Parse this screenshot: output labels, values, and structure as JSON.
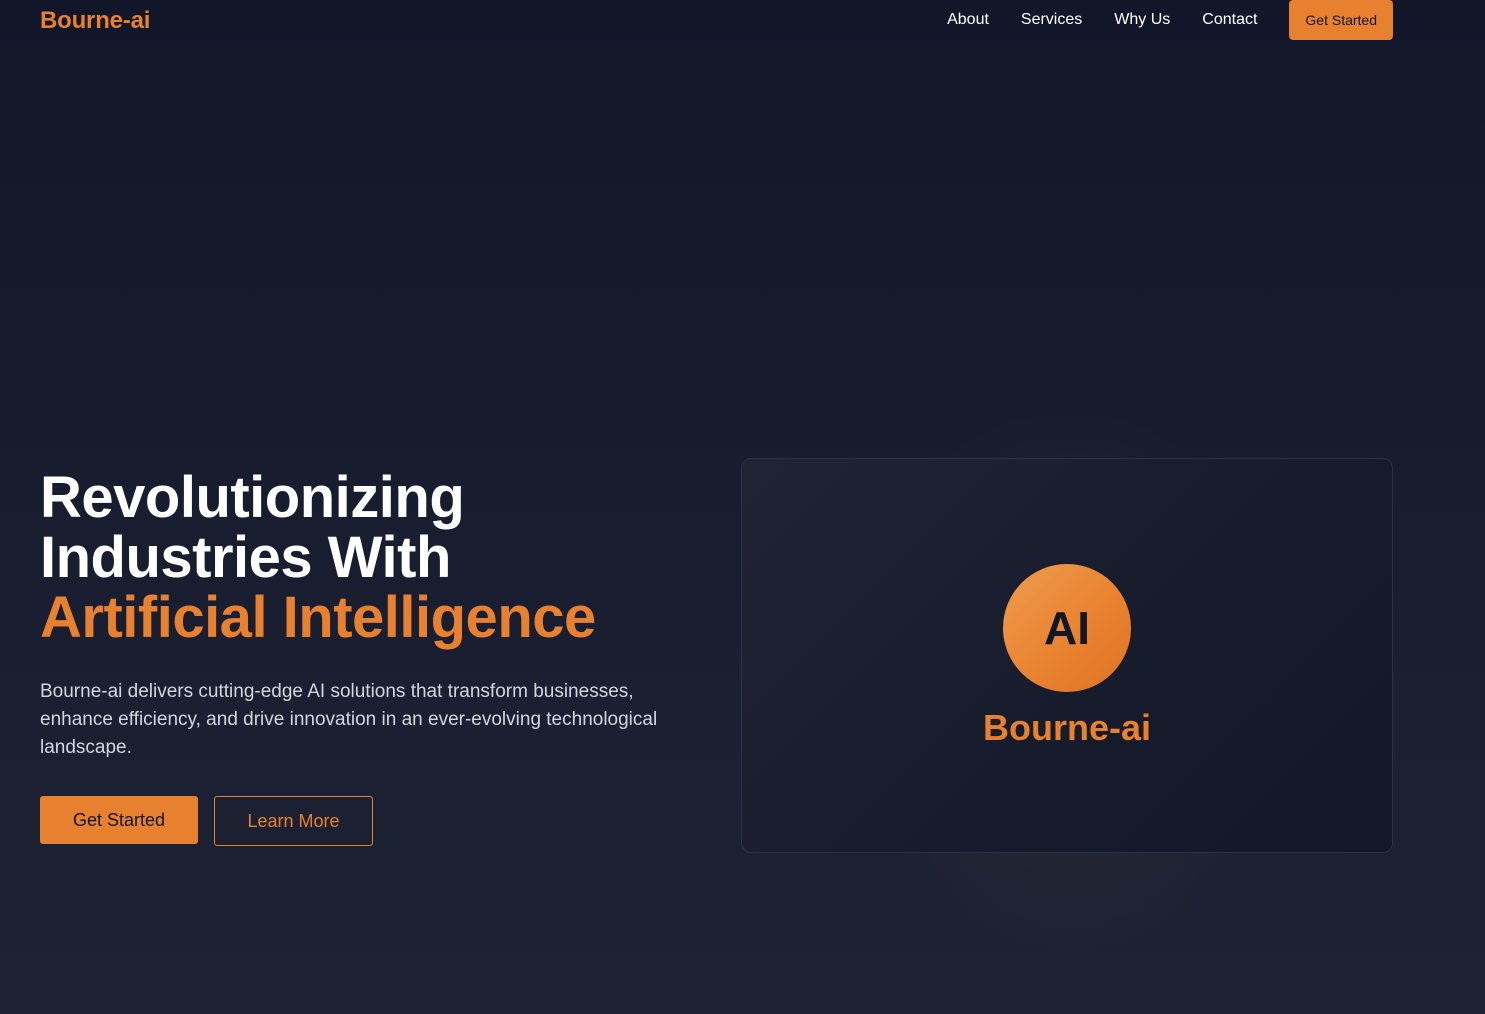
{
  "brand": {
    "name": "Bourne-ai",
    "accent_color": "#e8812f",
    "background_color": "#111629"
  },
  "nav": {
    "links": [
      {
        "label": "About"
      },
      {
        "label": "Services"
      },
      {
        "label": "Why Us"
      },
      {
        "label": "Contact"
      }
    ],
    "cta_label": "Get Started"
  },
  "hero": {
    "title_line1": "Revolutionizing",
    "title_line2": "Industries With",
    "title_accent": "Artificial Intelligence",
    "description": "Bourne-ai delivers cutting-edge AI solutions that transform businesses, enhance efficiency, and drive innovation in an ever-evolving technological landscape.",
    "primary_button": "Get Started",
    "secondary_button": "Learn More"
  },
  "card": {
    "badge_text": "AI",
    "brand_name": "Bourne-ai"
  }
}
